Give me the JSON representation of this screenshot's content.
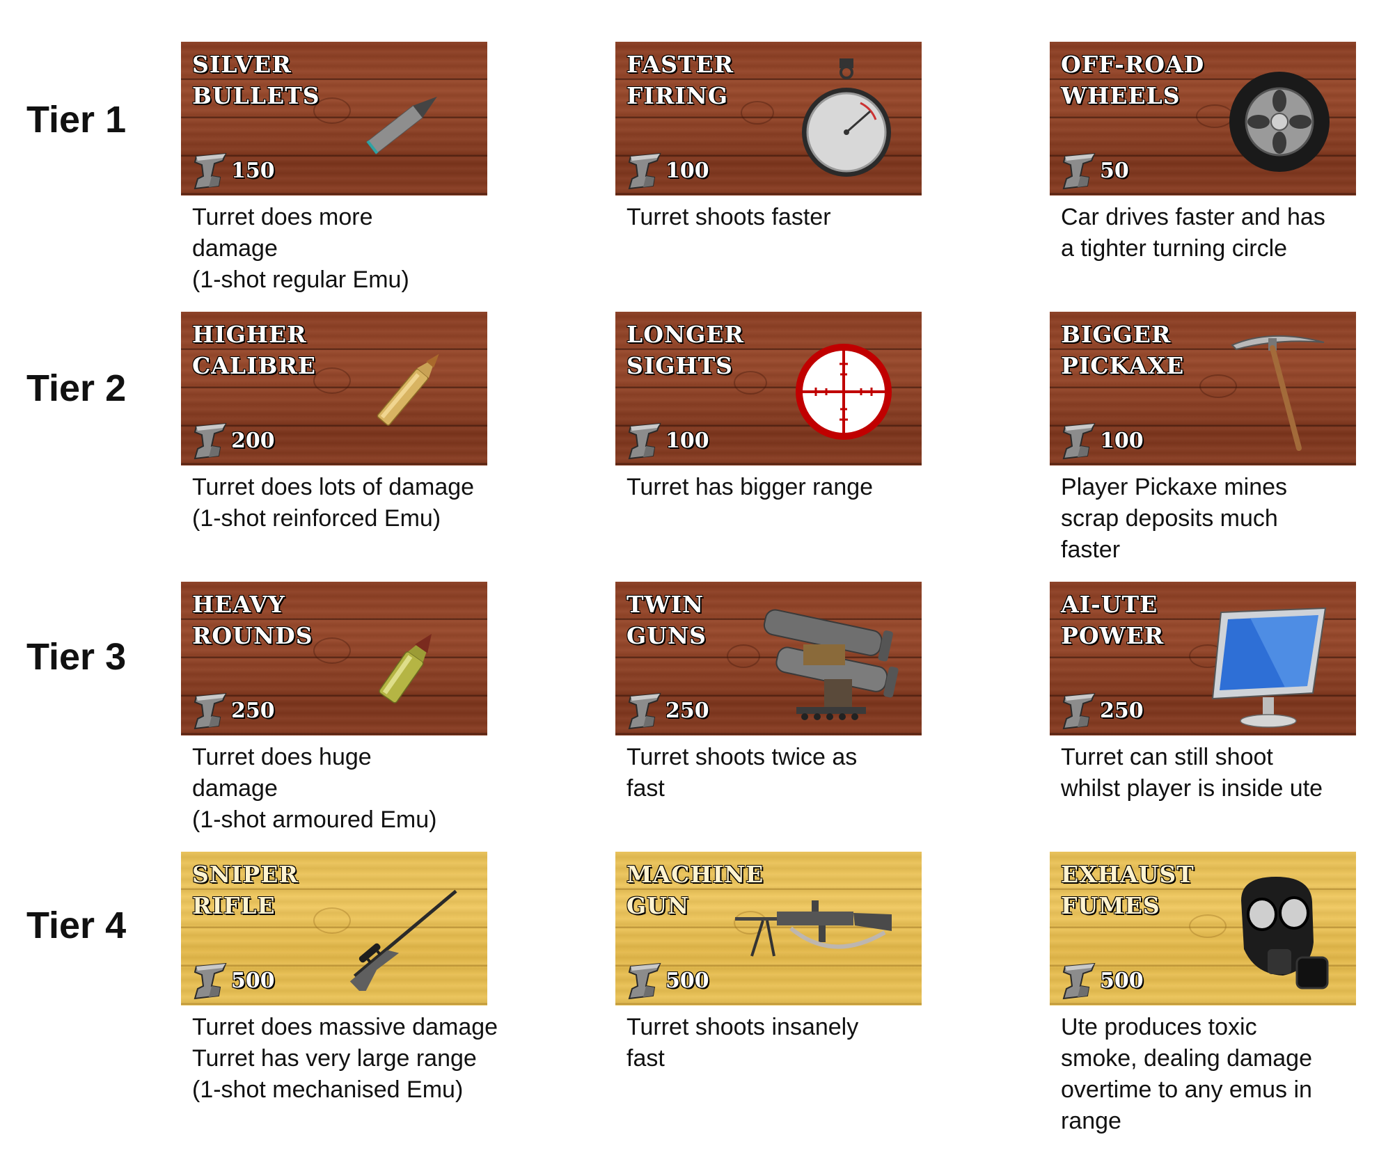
{
  "tiers": [
    {
      "label": "Tier 1",
      "upgrades": [
        {
          "title": [
            "SILVER",
            "BULLETS"
          ],
          "cost": "150",
          "icon": "bullet-icon",
          "theme": "wood",
          "description": [
            "Turret does more",
            "damage",
            "(1-shot regular Emu)"
          ]
        },
        {
          "title": [
            "FASTER",
            "FIRING"
          ],
          "cost": "100",
          "icon": "stopwatch-icon",
          "theme": "wood",
          "description": [
            "Turret shoots faster"
          ]
        },
        {
          "title": [
            "OFF-ROAD",
            "WHEELS"
          ],
          "cost": "50",
          "icon": "wheel-icon",
          "theme": "wood",
          "description": [
            "Car drives faster and has",
            "a tighter turning circle"
          ]
        }
      ]
    },
    {
      "label": "Tier 2",
      "upgrades": [
        {
          "title": [
            "HIGHER",
            "CALIBRE"
          ],
          "cost": "200",
          "icon": "brass-cartridge-icon",
          "theme": "wood",
          "description": [
            "Turret does lots of damage",
            "(1-shot reinforced Emu)"
          ]
        },
        {
          "title": [
            "LONGER",
            "SIGHTS"
          ],
          "cost": "100",
          "icon": "crosshair-icon",
          "theme": "wood",
          "description": [
            "Turret has bigger range"
          ]
        },
        {
          "title": [
            "BIGGER",
            "PICKAXE"
          ],
          "cost": "100",
          "icon": "pickaxe-icon",
          "theme": "wood",
          "description": [
            "Player Pickaxe mines",
            "scrap deposits much",
            "faster"
          ]
        }
      ]
    },
    {
      "label": "Tier 3",
      "upgrades": [
        {
          "title": [
            "HEAVY",
            "ROUNDS"
          ],
          "cost": "250",
          "icon": "heavy-round-icon",
          "theme": "wood",
          "description": [
            "Turret does huge",
            "damage",
            "(1-shot armoured Emu)"
          ]
        },
        {
          "title": [
            "TWIN",
            "GUNS"
          ],
          "cost": "250",
          "icon": "twin-cannon-icon",
          "theme": "wood",
          "description": [
            "Turret shoots twice as",
            "fast"
          ]
        },
        {
          "title": [
            "AI-UTE",
            "POWER"
          ],
          "cost": "250",
          "icon": "computer-monitor-icon",
          "theme": "wood",
          "description": [
            "Turret can still shoot",
            "whilst player is inside ute"
          ]
        }
      ]
    },
    {
      "label": "Tier 4",
      "upgrades": [
        {
          "title": [
            "SNIPER",
            "RIFLE"
          ],
          "cost": "500",
          "icon": "sniper-rifle-icon",
          "theme": "gold",
          "description": [
            "Turret does massive damage",
            "Turret has very large range",
            "(1-shot mechanised Emu)"
          ]
        },
        {
          "title": [
            "MACHINE",
            "GUN"
          ],
          "cost": "500",
          "icon": "machine-gun-icon",
          "theme": "gold",
          "description": [
            "Turret shoots insanely",
            "fast"
          ]
        },
        {
          "title": [
            "EXHAUST",
            "FUMES"
          ],
          "cost": "500",
          "icon": "gas-mask-icon",
          "theme": "gold",
          "description": [
            "Ute produces toxic",
            "smoke, dealing damage",
            "overtime to any emus in",
            "range"
          ]
        }
      ]
    }
  ],
  "colors": {
    "wood": "#8f4226",
    "gold": "#ebc356",
    "text": "#111111"
  }
}
